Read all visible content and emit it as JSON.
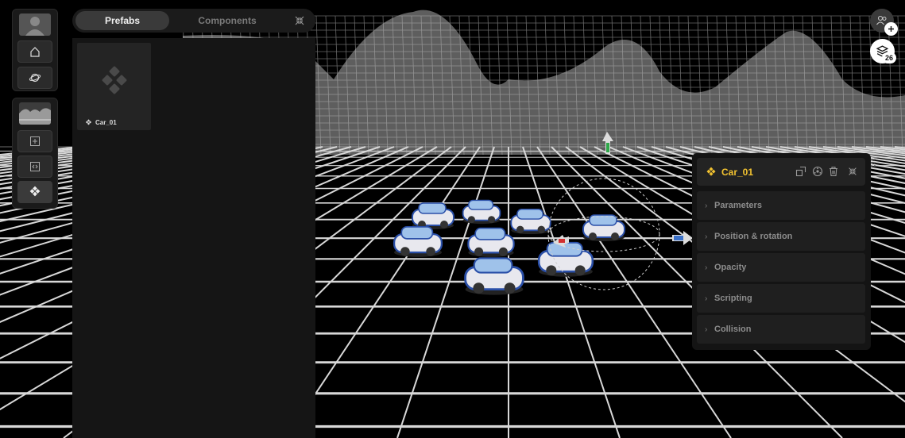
{
  "prefab_panel": {
    "tabs": [
      {
        "label": "Prefabs",
        "active": true
      },
      {
        "label": "Components",
        "active": false
      }
    ],
    "items": [
      {
        "label": "Car_01",
        "icon": "prefab-diamond-icon"
      }
    ]
  },
  "toolbar": {
    "icons": [
      "avatar-icon",
      "home-icon",
      "orbit-icon",
      "terrain-thumbnail",
      "add-icon",
      "code-icon",
      "prefab-diamond-icon"
    ]
  },
  "properties": {
    "title": "Car_01",
    "sections": [
      {
        "label": "Parameters"
      },
      {
        "label": "Position & rotation"
      },
      {
        "label": "Opacity"
      },
      {
        "label": "Scripting"
      },
      {
        "label": "Collision"
      }
    ],
    "colors": {
      "title": "#f2c230"
    }
  },
  "top_right": {
    "layers_count": "26"
  }
}
